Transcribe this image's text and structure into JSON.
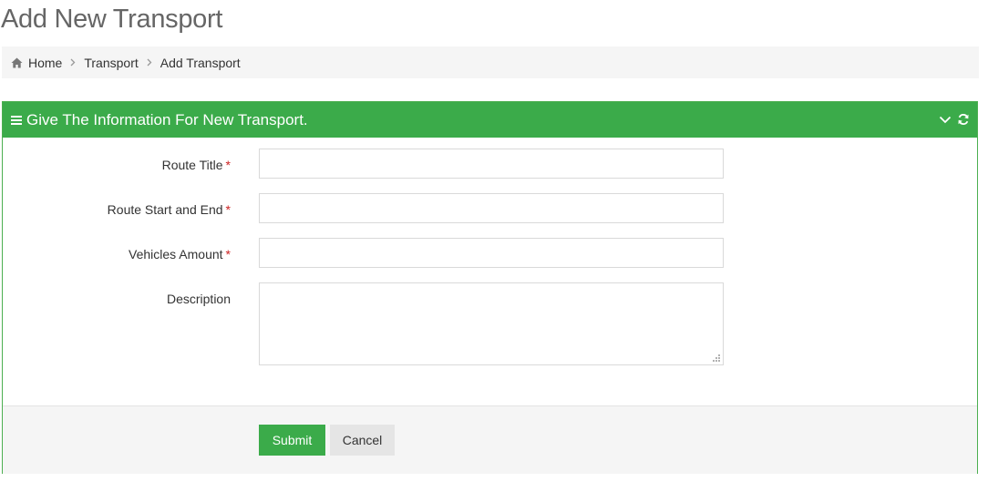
{
  "page": {
    "title": "Add New Transport"
  },
  "breadcrumb": [
    {
      "label": "Home"
    },
    {
      "label": "Transport"
    },
    {
      "label": "Add Transport"
    }
  ],
  "panel": {
    "heading": "Give The Information For New Transport.",
    "fields": {
      "route_title": {
        "label": "Route Title",
        "required": "*",
        "value": ""
      },
      "route_start_end": {
        "label": "Route Start and End",
        "required": "*",
        "value": ""
      },
      "vehicles_amount": {
        "label": "Vehicles Amount",
        "required": "*",
        "value": ""
      },
      "description": {
        "label": "Description",
        "value": ""
      }
    },
    "buttons": {
      "submit": "Submit",
      "cancel": "Cancel"
    }
  },
  "colors": {
    "accent": "#3bab4a",
    "required": "#cc2222",
    "footer_bg": "#f5f5f5"
  },
  "icons": [
    "home-icon",
    "chevron-right-icon",
    "bars-icon",
    "chevron-down-icon",
    "refresh-icon",
    "resize-grip-icon"
  ]
}
